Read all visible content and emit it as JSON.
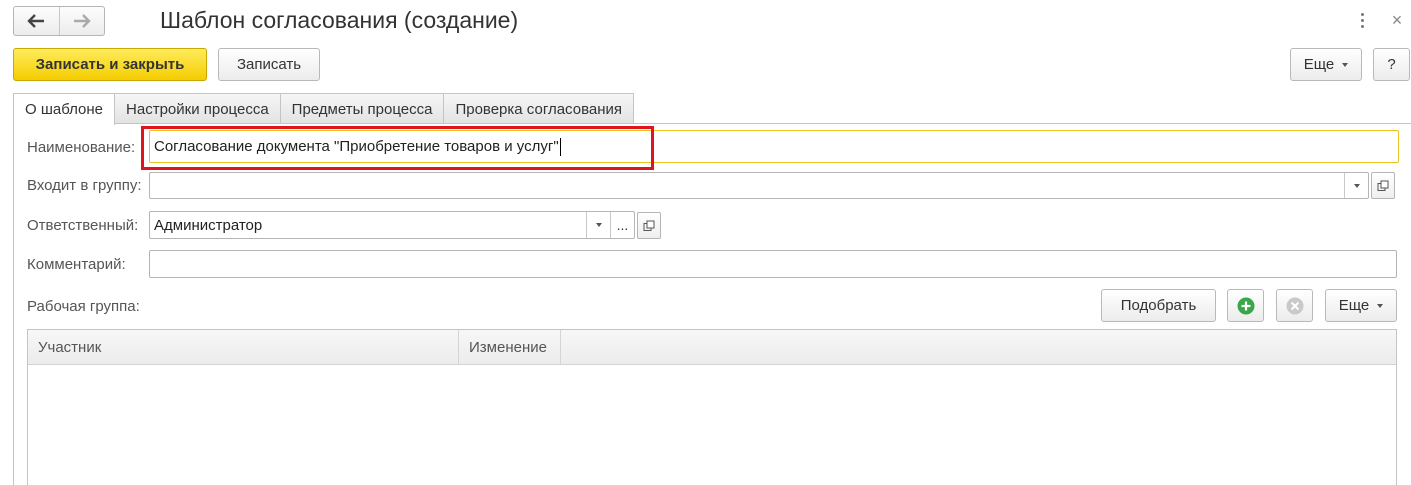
{
  "window": {
    "title": "Шаблон согласования (создание)"
  },
  "toolbar": {
    "save_close_label": "Записать и закрыть",
    "save_label": "Записать",
    "more_label": "Еще",
    "help_label": "?"
  },
  "tabs": [
    {
      "label": "О шаблоне",
      "active": true
    },
    {
      "label": "Настройки процесса"
    },
    {
      "label": "Предметы процесса"
    },
    {
      "label": "Проверка согласования"
    }
  ],
  "form": {
    "name_label": "Наименование:",
    "name_value": "Согласование документа \"Приобретение товаров и услуг\"",
    "group_label": "Входит в группу:",
    "group_value": "",
    "responsible_label": "Ответственный:",
    "responsible_value": "Администратор",
    "select_label": "...",
    "comment_label": "Комментарий:",
    "comment_value": ""
  },
  "workgroup": {
    "label": "Рабочая группа:",
    "pick_label": "Подобрать",
    "more_label": "Еще",
    "columns": [
      "Участник",
      "Изменение"
    ]
  },
  "colors": {
    "primary_button": "#f4cc00",
    "highlight": "#e0141e",
    "focus_border": "#f0c020",
    "add_icon": "#3aa64a"
  },
  "icons": [
    "back-arrow-icon",
    "forward-arrow-icon",
    "more-vertical-icon",
    "close-icon",
    "dropdown-icon",
    "open-form-icon",
    "add-icon",
    "delete-icon"
  ]
}
